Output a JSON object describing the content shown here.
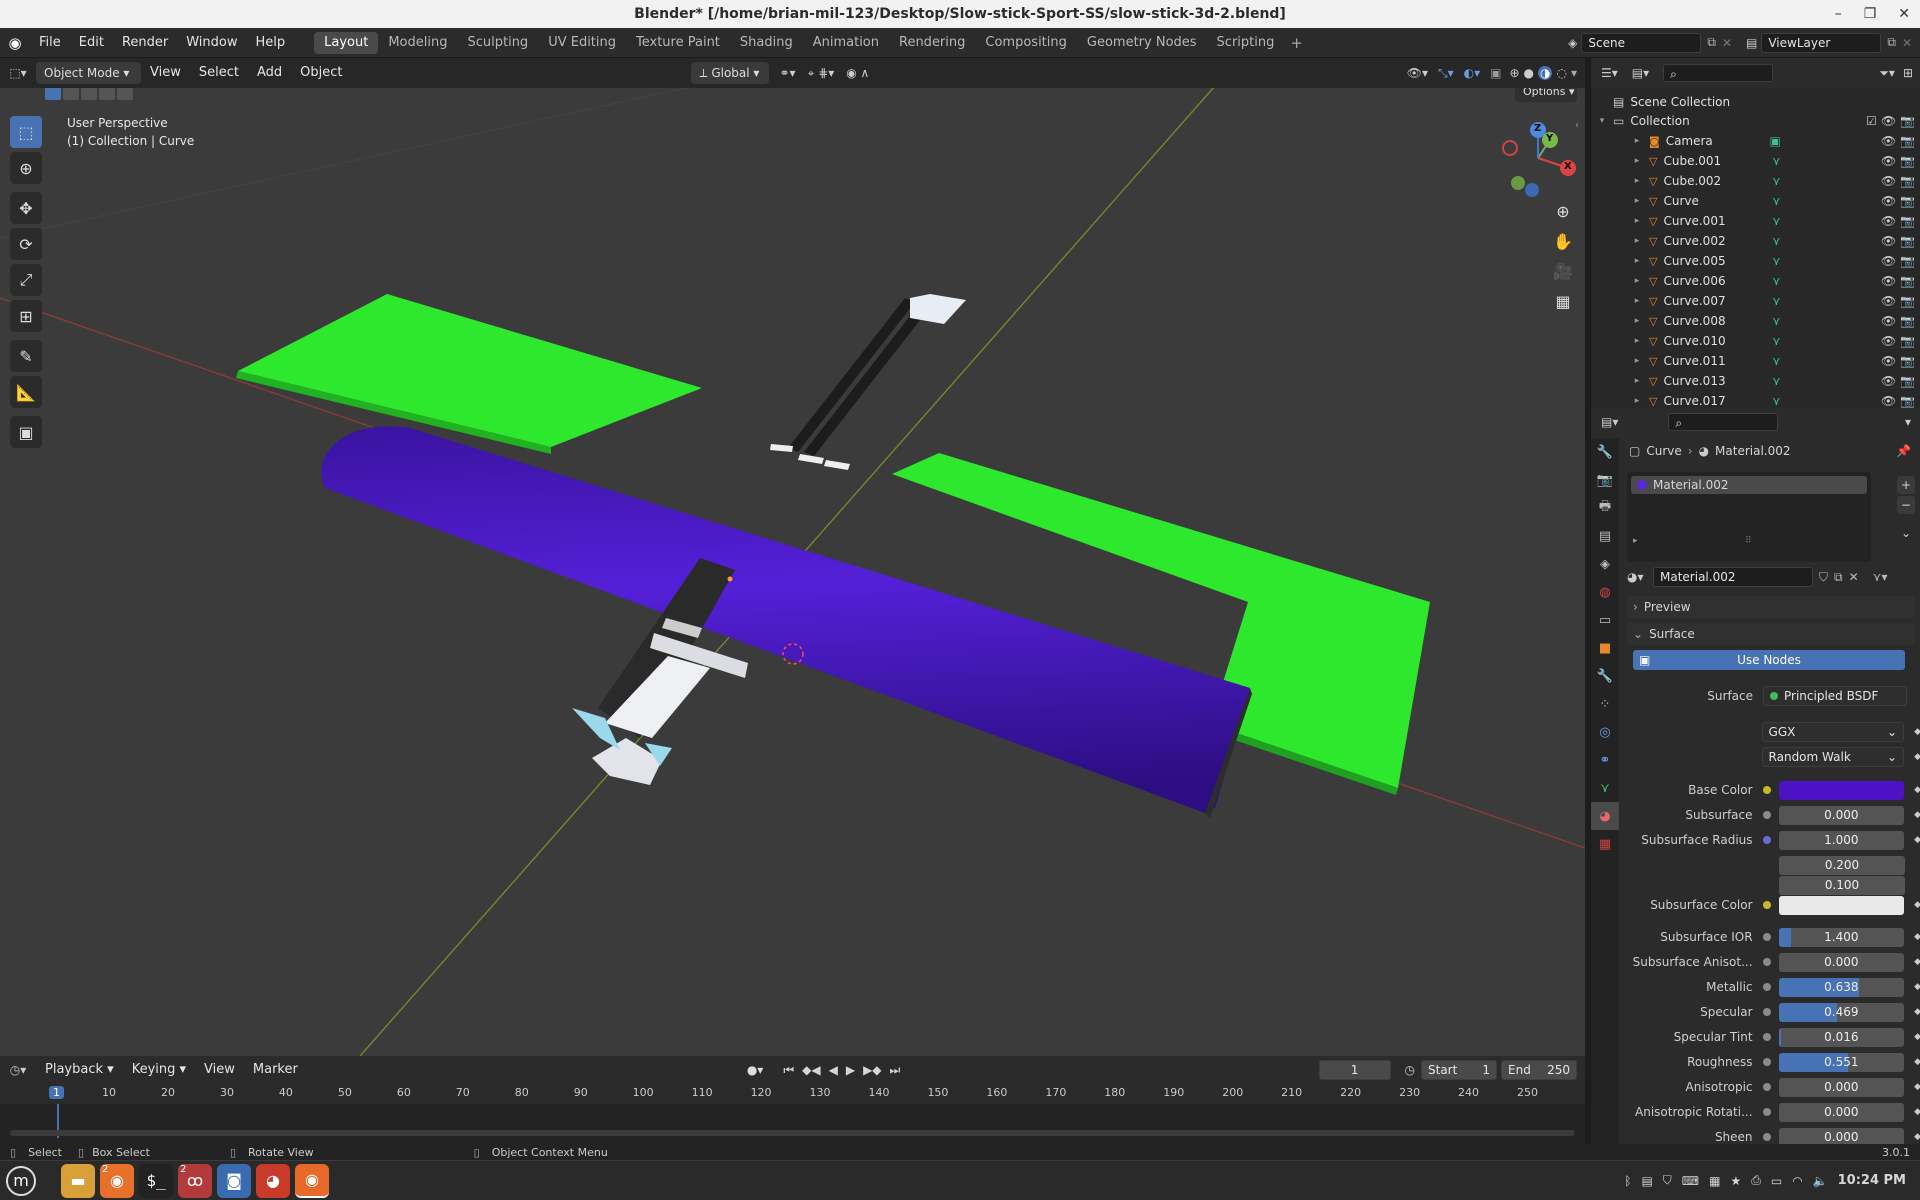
{
  "window": {
    "title": "Blender* [/home/brian-mil-123/Desktop/Slow-stick-Sport-SS/slow-stick-3d-2.blend]"
  },
  "menus": [
    "File",
    "Edit",
    "Render",
    "Window",
    "Help"
  ],
  "workspaces": [
    "Layout",
    "Modeling",
    "Sculpting",
    "UV Editing",
    "Texture Paint",
    "Shading",
    "Animation",
    "Rendering",
    "Compositing",
    "Geometry Nodes",
    "Scripting"
  ],
  "active_workspace": "Layout",
  "scene": {
    "name": "Scene",
    "view_layer": "ViewLayer"
  },
  "viewport_header": {
    "mode": "Object Mode",
    "menus": [
      "View",
      "Select",
      "Add",
      "Object"
    ],
    "orientation": "Global",
    "options": "Options"
  },
  "viewport": {
    "perspective": "User Perspective",
    "collection": "(1) Collection | Curve"
  },
  "gizmo": {
    "x": "X",
    "y": "Y",
    "z": "Z"
  },
  "outliner": {
    "root": "Scene Collection",
    "collection": "Collection",
    "items": [
      "Camera",
      "Cube.001",
      "Cube.002",
      "Curve",
      "Curve.001",
      "Curve.002",
      "Curve.005",
      "Curve.006",
      "Curve.007",
      "Curve.008",
      "Curve.010",
      "Curve.011",
      "Curve.013",
      "Curve.017"
    ]
  },
  "properties": {
    "breadcrumb_object": "Curve",
    "breadcrumb_material": "Material.002",
    "slot": "Material.002",
    "material_name": "Material.002",
    "sections": {
      "preview": "Preview",
      "surface": "Surface"
    },
    "use_nodes": "Use Nodes",
    "surface_label": "Surface",
    "shader": "Principled BSDF",
    "distribution": "GGX",
    "subsurface_method": "Random Walk",
    "base_color_hex": "#4d12c4",
    "subsurface_color_hex": "#e9e9e9",
    "fields": [
      {
        "label": "Base Color",
        "type": "color"
      },
      {
        "label": "Subsurface",
        "value": "0.000",
        "fill": 0
      },
      {
        "label": "Subsurface Radius",
        "value": "1.000",
        "fill": 0
      },
      {
        "label": "",
        "value": "0.200",
        "fill": 0
      },
      {
        "label": "",
        "value": "0.100",
        "fill": 0
      },
      {
        "label": "Subsurface Color",
        "type": "color"
      },
      {
        "label": "Subsurface IOR",
        "value": "1.400",
        "fill": 0.1
      },
      {
        "label": "Subsurface Anisot...",
        "value": "0.000",
        "fill": 0
      },
      {
        "label": "Metallic",
        "value": "0.638",
        "fill": 0.638
      },
      {
        "label": "Specular",
        "value": "0.469",
        "fill": 0.469
      },
      {
        "label": "Specular Tint",
        "value": "0.016",
        "fill": 0.016
      },
      {
        "label": "Roughness",
        "value": "0.551",
        "fill": 0.551
      },
      {
        "label": "Anisotropic",
        "value": "0.000",
        "fill": 0
      },
      {
        "label": "Anisotropic Rotati...",
        "value": "0.000",
        "fill": 0
      },
      {
        "label": "Sheen",
        "value": "0.000",
        "fill": 0
      }
    ]
  },
  "timeline": {
    "menus": [
      "Playback",
      "Keying",
      "View",
      "Marker"
    ],
    "current_frame": "1",
    "start_label": "Start",
    "start": "1",
    "end_label": "End",
    "end": "250",
    "ticks": [
      "1",
      "10",
      "20",
      "30",
      "40",
      "50",
      "60",
      "70",
      "80",
      "90",
      "100",
      "110",
      "120",
      "130",
      "140",
      "150",
      "160",
      "170",
      "180",
      "190",
      "200",
      "210",
      "220",
      "230",
      "240",
      "250"
    ]
  },
  "status": {
    "select": "Select",
    "box_select": "Box Select",
    "rotate": "Rotate View",
    "context": "Object Context Menu",
    "version": "3.0.1"
  },
  "taskbar": {
    "clock": "10:24 PM",
    "badge1": "2",
    "badge2": "2"
  }
}
